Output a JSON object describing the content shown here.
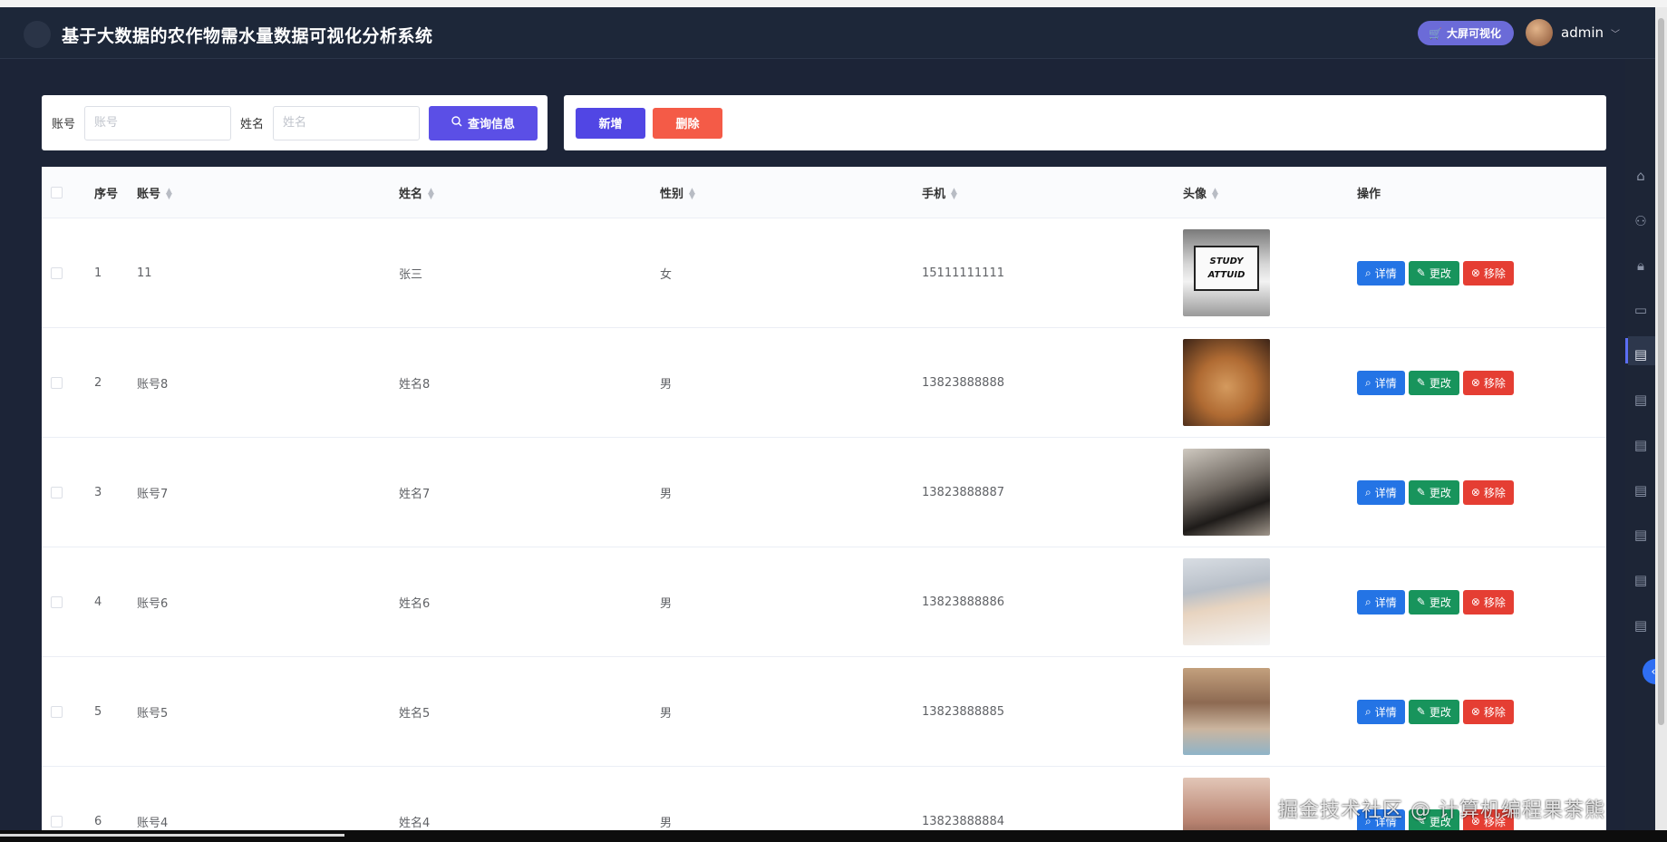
{
  "header": {
    "title": "基于大数据的农作物需水量数据可视化分析系统",
    "bigscreen_label": "大屏可视化",
    "username": "admin"
  },
  "search": {
    "account_label": "账号",
    "account_placeholder": "账号",
    "name_label": "姓名",
    "name_placeholder": "姓名",
    "query_label": "查询信息"
  },
  "actions": {
    "add_label": "新增",
    "delete_label": "删除"
  },
  "table": {
    "headers": {
      "index": "序号",
      "account": "账号",
      "name": "姓名",
      "gender": "性别",
      "phone": "手机",
      "avatar": "头像",
      "ops": "操作"
    },
    "op_labels": {
      "detail": "详情",
      "edit": "更改",
      "remove": "移除"
    },
    "rows": [
      {
        "index": "1",
        "account": "11",
        "name": "张三",
        "gender": "女",
        "phone": "15111111111",
        "avatar_text": "STUDY ATTUID"
      },
      {
        "index": "2",
        "account": "账号8",
        "name": "姓名8",
        "gender": "男",
        "phone": "13823888888"
      },
      {
        "index": "3",
        "account": "账号7",
        "name": "姓名7",
        "gender": "男",
        "phone": "13823888887"
      },
      {
        "index": "4",
        "account": "账号6",
        "name": "姓名6",
        "gender": "男",
        "phone": "13823888886"
      },
      {
        "index": "5",
        "account": "账号5",
        "name": "姓名5",
        "gender": "男",
        "phone": "13823888885"
      },
      {
        "index": "6",
        "account": "账号4",
        "name": "姓名4",
        "gender": "男",
        "phone": "13823888884"
      }
    ]
  },
  "watermark": "掘金技术社区 @ 计算机编程果茶熊",
  "colors": {
    "header_bg": "#1d2739",
    "primary": "#5b4fe6",
    "danger": "#f45b47",
    "detail": "#2474e5",
    "edit": "#18945c",
    "remove": "#e53e33"
  },
  "rail_icons": [
    "home-icon",
    "user-icon",
    "lock-icon",
    "chart-board-icon",
    "document-icon",
    "document-icon",
    "document-icon",
    "document-icon",
    "document-icon",
    "document-icon",
    "document-icon"
  ]
}
